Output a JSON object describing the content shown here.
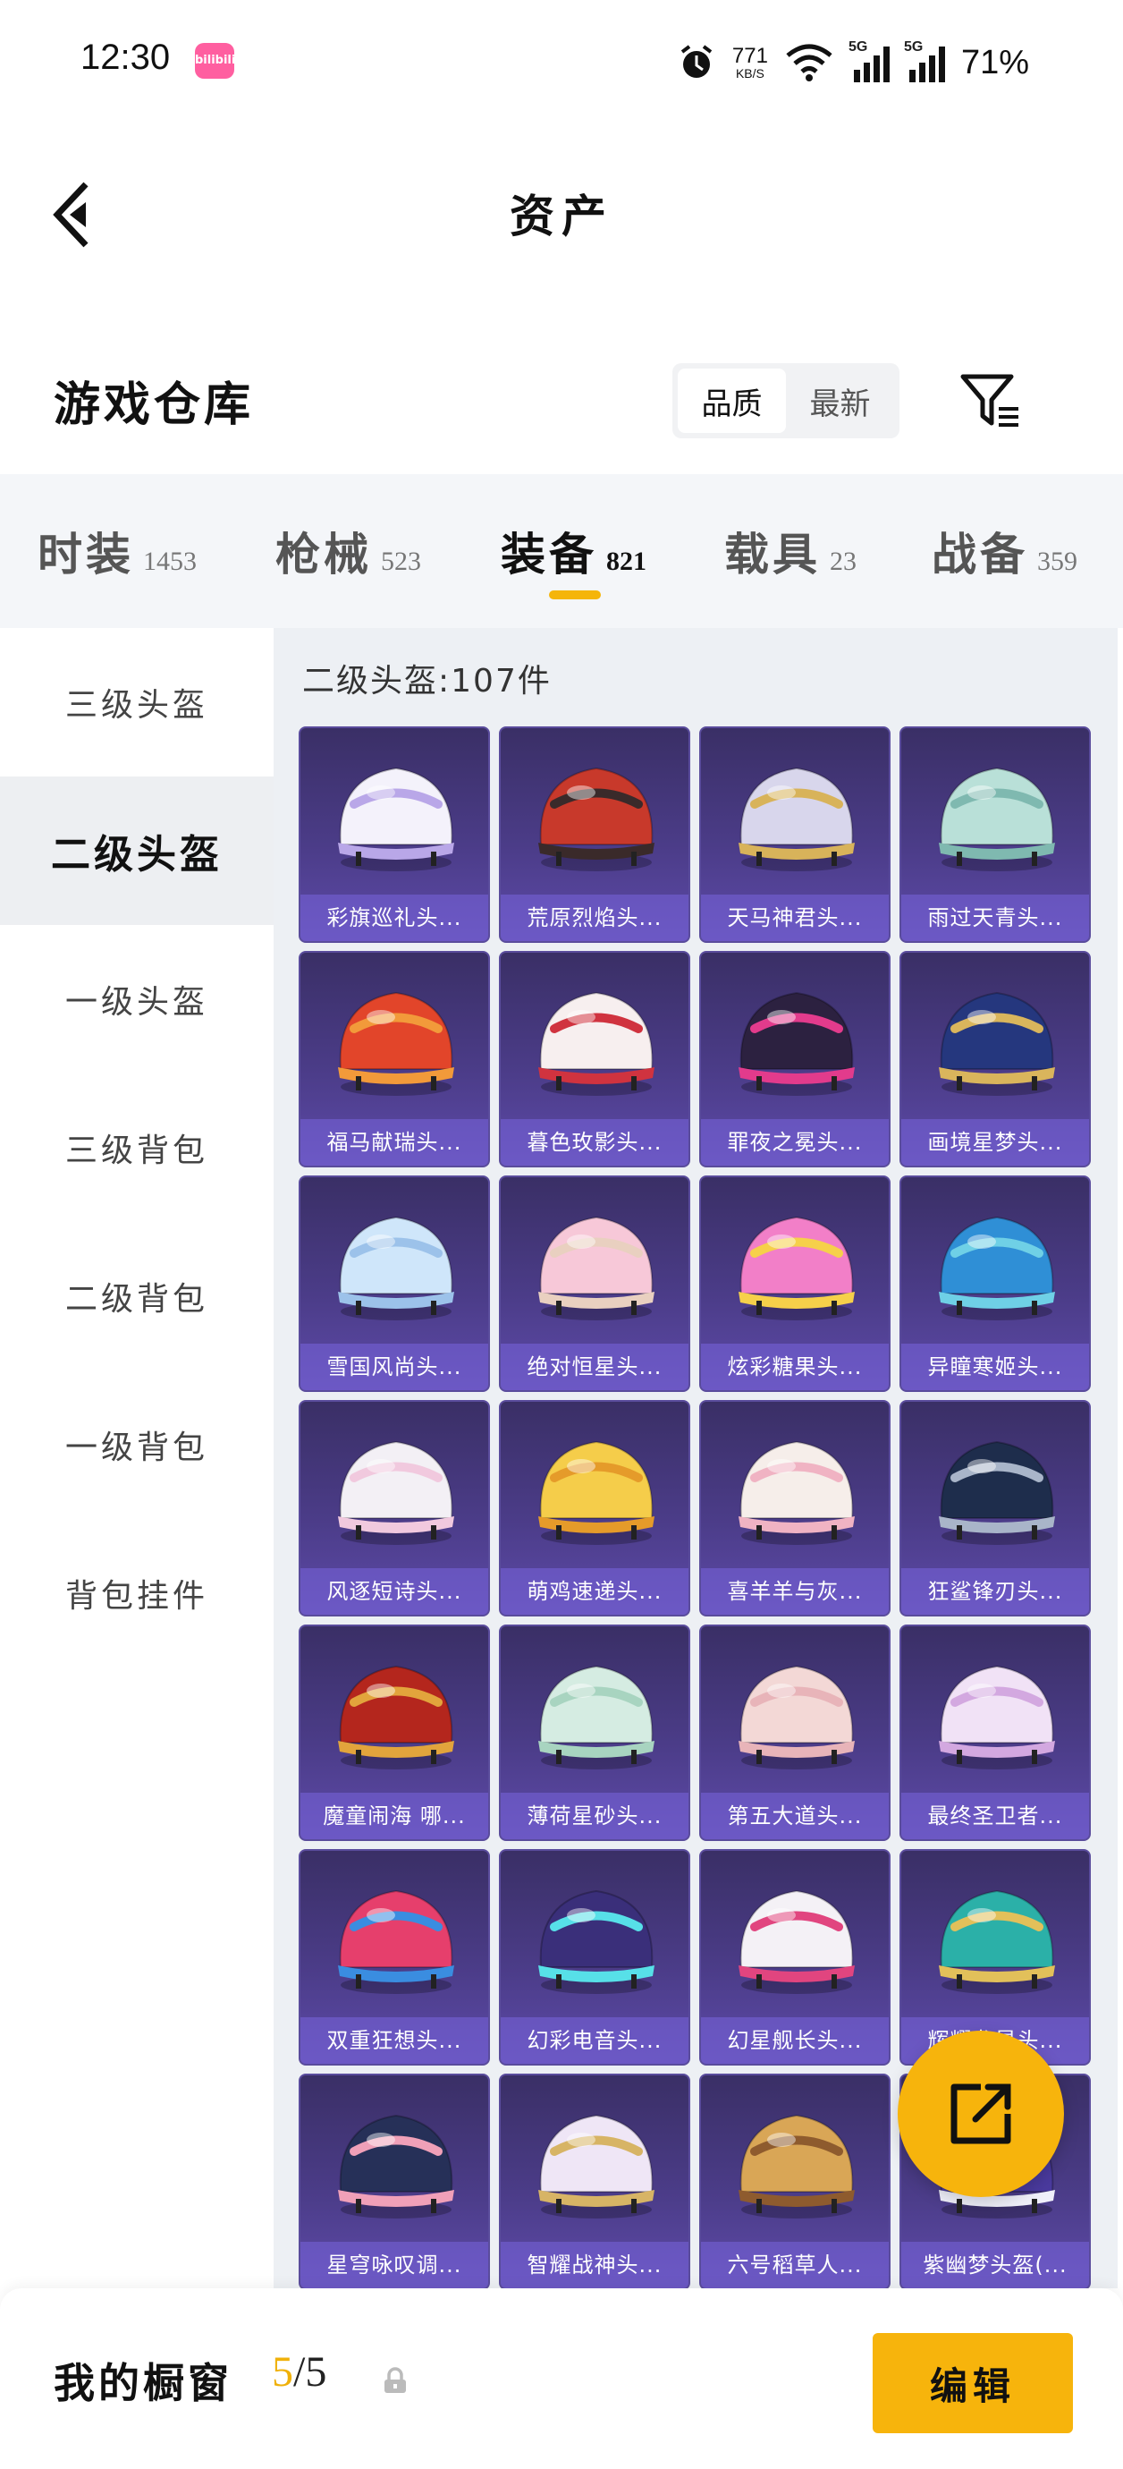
{
  "status_bar": {
    "time": "12:30",
    "app_badge": "bilibili",
    "net_speed_value": "771",
    "net_speed_unit": "KB/S",
    "signal_1_label": "5G",
    "signal_2_label": "5G",
    "battery": "71%"
  },
  "header": {
    "title": "资产"
  },
  "section": {
    "title": "游戏仓库"
  },
  "sort": {
    "options": [
      "品质",
      "最新"
    ],
    "active": "品质"
  },
  "tabs": [
    {
      "name": "时装",
      "count": "1453"
    },
    {
      "name": "枪械",
      "count": "523"
    },
    {
      "name": "装备",
      "count": "821"
    },
    {
      "name": "载具",
      "count": "23"
    },
    {
      "name": "战备",
      "count": "359"
    }
  ],
  "active_tab": "装备",
  "sidebar": {
    "items": [
      "三级头盔",
      "二级头盔",
      "一级头盔",
      "三级背包",
      "二级背包",
      "一级背包",
      "背包挂件"
    ],
    "active": "二级头盔"
  },
  "grid": {
    "title": "二级头盔:107件",
    "items": [
      {
        "name": "彩旗巡礼头...",
        "colors": [
          "#f4f2fb",
          "#b9a7e8"
        ]
      },
      {
        "name": "荒原烈焰头...",
        "colors": [
          "#c8392b",
          "#3a2a2a"
        ]
      },
      {
        "name": "天马神君头...",
        "colors": [
          "#d8d6ec",
          "#d8b35a"
        ]
      },
      {
        "name": "雨过天青头...",
        "colors": [
          "#b9e0d8",
          "#7fb9b0"
        ]
      },
      {
        "name": "福马献瑞头...",
        "colors": [
          "#e2452a",
          "#f29a3a"
        ]
      },
      {
        "name": "暮色玫影头...",
        "colors": [
          "#f7efef",
          "#d0333f"
        ]
      },
      {
        "name": "罪夜之冕头...",
        "colors": [
          "#2c2140",
          "#e23b8c"
        ]
      },
      {
        "name": "画境星梦头...",
        "colors": [
          "#25377e",
          "#d9b55c"
        ]
      },
      {
        "name": "雪国风尚头...",
        "colors": [
          "#cfe6fa",
          "#9cc2ea"
        ]
      },
      {
        "name": "绝对恒星头...",
        "colors": [
          "#f7c8d8",
          "#e9d0c0"
        ]
      },
      {
        "name": "炫彩糖果头...",
        "colors": [
          "#f27fc8",
          "#f6d04a"
        ]
      },
      {
        "name": "异瞳寒姬头...",
        "colors": [
          "#2f8fd6",
          "#6fd0e6"
        ]
      },
      {
        "name": "风逐短诗头...",
        "colors": [
          "#f3f0f5",
          "#f1c9de"
        ]
      },
      {
        "name": "萌鸡速递头...",
        "colors": [
          "#f5cd4a",
          "#e59b2a"
        ]
      },
      {
        "name": "喜羊羊与灰...",
        "colors": [
          "#f6eeea",
          "#f0b3c3"
        ]
      },
      {
        "name": "狂鲨锋刃头...",
        "colors": [
          "#1e2d4c",
          "#a9b5c9"
        ]
      },
      {
        "name": "魔童闹海 哪...",
        "colors": [
          "#b4261d",
          "#e2a43c"
        ]
      },
      {
        "name": "薄荷星砂头...",
        "colors": [
          "#d5ece2",
          "#a8d4c0"
        ]
      },
      {
        "name": "第五大道头...",
        "colors": [
          "#f3d8d6",
          "#e8b4b9"
        ]
      },
      {
        "name": "最终圣卫者...",
        "colors": [
          "#f1e2f6",
          "#d3a8e0"
        ]
      },
      {
        "name": "双重狂想头...",
        "colors": [
          "#e63f6c",
          "#3a8de0"
        ]
      },
      {
        "name": "幻彩电音头...",
        "colors": [
          "#3a2f7a",
          "#57e0e8"
        ]
      },
      {
        "name": "幻星舰长头...",
        "colors": [
          "#f4f1f6",
          "#e1457f"
        ]
      },
      {
        "name": "辉耀龙星头...",
        "colors": [
          "#2bb0a8",
          "#e2c05a"
        ]
      },
      {
        "name": "星穹咏叹调...",
        "colors": [
          "#263058",
          "#f0a0b8"
        ]
      },
      {
        "name": "智耀战神头...",
        "colors": [
          "#efe6f6",
          "#d7b465"
        ]
      },
      {
        "name": "六号稻草人...",
        "colors": [
          "#d9a656",
          "#8e5b2e"
        ]
      },
      {
        "name": "紫幽梦头盔(...",
        "colors": [
          "#4a3a9e",
          "#f0f0fa"
        ]
      }
    ]
  },
  "fab": {
    "icon": "share-external-icon"
  },
  "bottom": {
    "showcase_label": "我的橱窗",
    "showcase_current": "5",
    "showcase_separator": "/",
    "showcase_total": "5",
    "edit_label": "编辑"
  },
  "theme": {
    "accent": "#f7b40c",
    "card_top": "#3a2f66",
    "card_bottom": "#5d4aa8"
  }
}
